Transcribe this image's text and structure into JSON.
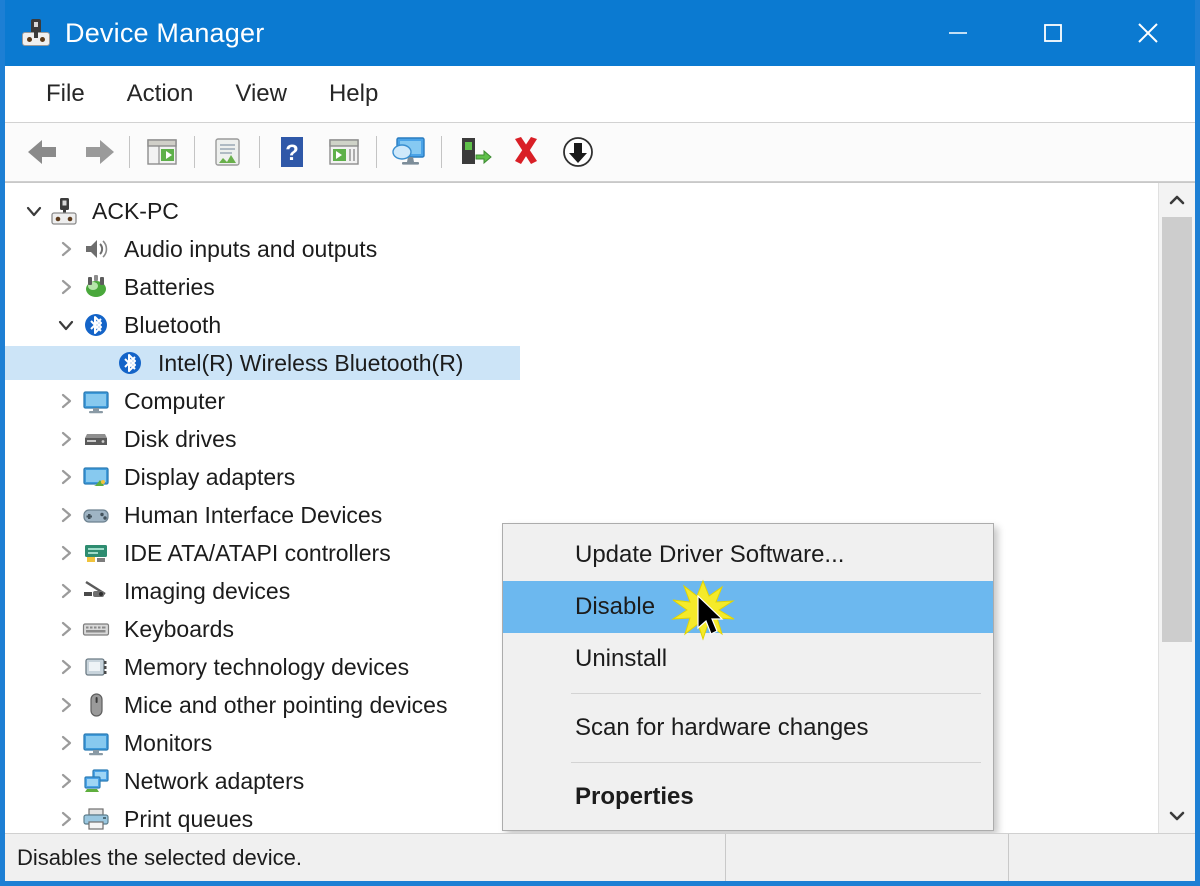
{
  "window": {
    "title": "Device Manager",
    "icon": "device-manager-icon",
    "accent_color": "#0b7ad1",
    "controls": [
      {
        "name": "minimize-button",
        "glyph": "minimize"
      },
      {
        "name": "maximize-button",
        "glyph": "maximize"
      },
      {
        "name": "close-button",
        "glyph": "close"
      }
    ]
  },
  "menubar": {
    "items": [
      {
        "label": "File"
      },
      {
        "label": "Action"
      },
      {
        "label": "View"
      },
      {
        "label": "Help"
      }
    ]
  },
  "toolbar": {
    "buttons": [
      {
        "name": "back-button",
        "icon": "back-arrow-icon",
        "tooltip": "Back"
      },
      {
        "name": "forward-button",
        "icon": "forward-arrow-icon",
        "tooltip": "Forward"
      },
      {
        "name": "show-hide-console-tree-button",
        "icon": "console-tree-icon",
        "tooltip": "Show/Hide Console Tree"
      },
      {
        "name": "properties-button",
        "icon": "properties-icon",
        "tooltip": "Properties"
      },
      {
        "name": "help-button",
        "icon": "help-question-icon",
        "tooltip": "Help"
      },
      {
        "name": "devices-by-type-button",
        "icon": "devices-by-type-icon",
        "tooltip": "Devices by type"
      },
      {
        "name": "scan-for-hardware-changes-button",
        "icon": "scan-hardware-icon",
        "tooltip": "Scan for hardware changes"
      },
      {
        "name": "update-driver-button",
        "icon": "update-driver-icon",
        "tooltip": "Update Driver Software"
      },
      {
        "name": "uninstall-button",
        "icon": "red-x-icon",
        "tooltip": "Uninstall"
      },
      {
        "name": "disable-button",
        "icon": "disable-down-arrow-icon",
        "tooltip": "Disable"
      }
    ]
  },
  "tree": {
    "root": {
      "label": "ACK-PC",
      "icon": "computer-chip-icon",
      "expanded": true
    },
    "items": [
      {
        "label": "Audio inputs and outputs",
        "icon": "speaker-icon",
        "level": 1,
        "expander": "collapsed",
        "selected": false
      },
      {
        "label": "Batteries",
        "icon": "battery-icon",
        "level": 1,
        "expander": "collapsed",
        "selected": false
      },
      {
        "label": "Bluetooth",
        "icon": "bluetooth-icon",
        "level": 1,
        "expander": "expanded",
        "selected": false
      },
      {
        "label": "Intel(R) Wireless Bluetooth(R)",
        "icon": "bluetooth-icon",
        "level": 2,
        "expander": "none",
        "selected": true
      },
      {
        "label": "Computer",
        "icon": "monitor-icon",
        "level": 1,
        "expander": "collapsed",
        "selected": false
      },
      {
        "label": "Disk drives",
        "icon": "disk-drive-icon",
        "level": 1,
        "expander": "collapsed",
        "selected": false
      },
      {
        "label": "Display adapters",
        "icon": "display-adapter-icon",
        "level": 1,
        "expander": "collapsed",
        "selected": false
      },
      {
        "label": "Human Interface Devices",
        "icon": "hid-icon",
        "level": 1,
        "expander": "collapsed",
        "selected": false
      },
      {
        "label": "IDE ATA/ATAPI controllers",
        "icon": "ide-controller-icon",
        "level": 1,
        "expander": "collapsed",
        "selected": false
      },
      {
        "label": "Imaging devices",
        "icon": "imaging-device-icon",
        "level": 1,
        "expander": "collapsed",
        "selected": false
      },
      {
        "label": "Keyboards",
        "icon": "keyboard-icon",
        "level": 1,
        "expander": "collapsed",
        "selected": false
      },
      {
        "label": "Memory technology devices",
        "icon": "memory-device-icon",
        "level": 1,
        "expander": "collapsed",
        "selected": false
      },
      {
        "label": "Mice and other pointing devices",
        "icon": "mouse-icon",
        "level": 1,
        "expander": "collapsed",
        "selected": false
      },
      {
        "label": "Monitors",
        "icon": "monitor-icon",
        "level": 1,
        "expander": "collapsed",
        "selected": false
      },
      {
        "label": "Network adapters",
        "icon": "network-adapter-icon",
        "level": 1,
        "expander": "collapsed",
        "selected": false
      },
      {
        "label": "Print queues",
        "icon": "printer-icon",
        "level": 1,
        "expander": "collapsed",
        "selected": false
      }
    ],
    "selection_color": "#cce4f7"
  },
  "context_menu": {
    "highlight_color": "#6cb8ef",
    "entries": [
      {
        "label": "Update Driver Software...",
        "name": "ctx-update-driver-software",
        "type": "item",
        "selected": false,
        "bold": false
      },
      {
        "label": "Disable",
        "name": "ctx-disable",
        "type": "item",
        "selected": true,
        "bold": false
      },
      {
        "label": "Uninstall",
        "name": "ctx-uninstall",
        "type": "item",
        "selected": false,
        "bold": false
      },
      {
        "type": "separator",
        "name": "ctx-separator-1"
      },
      {
        "label": "Scan for hardware changes",
        "name": "ctx-scan-for-hardware-changes",
        "type": "item",
        "selected": false,
        "bold": false
      },
      {
        "type": "separator",
        "name": "ctx-separator-2"
      },
      {
        "label": "Properties",
        "name": "ctx-properties",
        "type": "item",
        "selected": false,
        "bold": true
      }
    ]
  },
  "statusbar": {
    "message": "Disables the selected device.",
    "pane2": "",
    "pane3": ""
  },
  "scrollbar": {
    "up_arrow": "scroll-up-arrow-icon",
    "down_arrow": "scroll-down-arrow-icon",
    "thumb": "scroll-thumb"
  }
}
